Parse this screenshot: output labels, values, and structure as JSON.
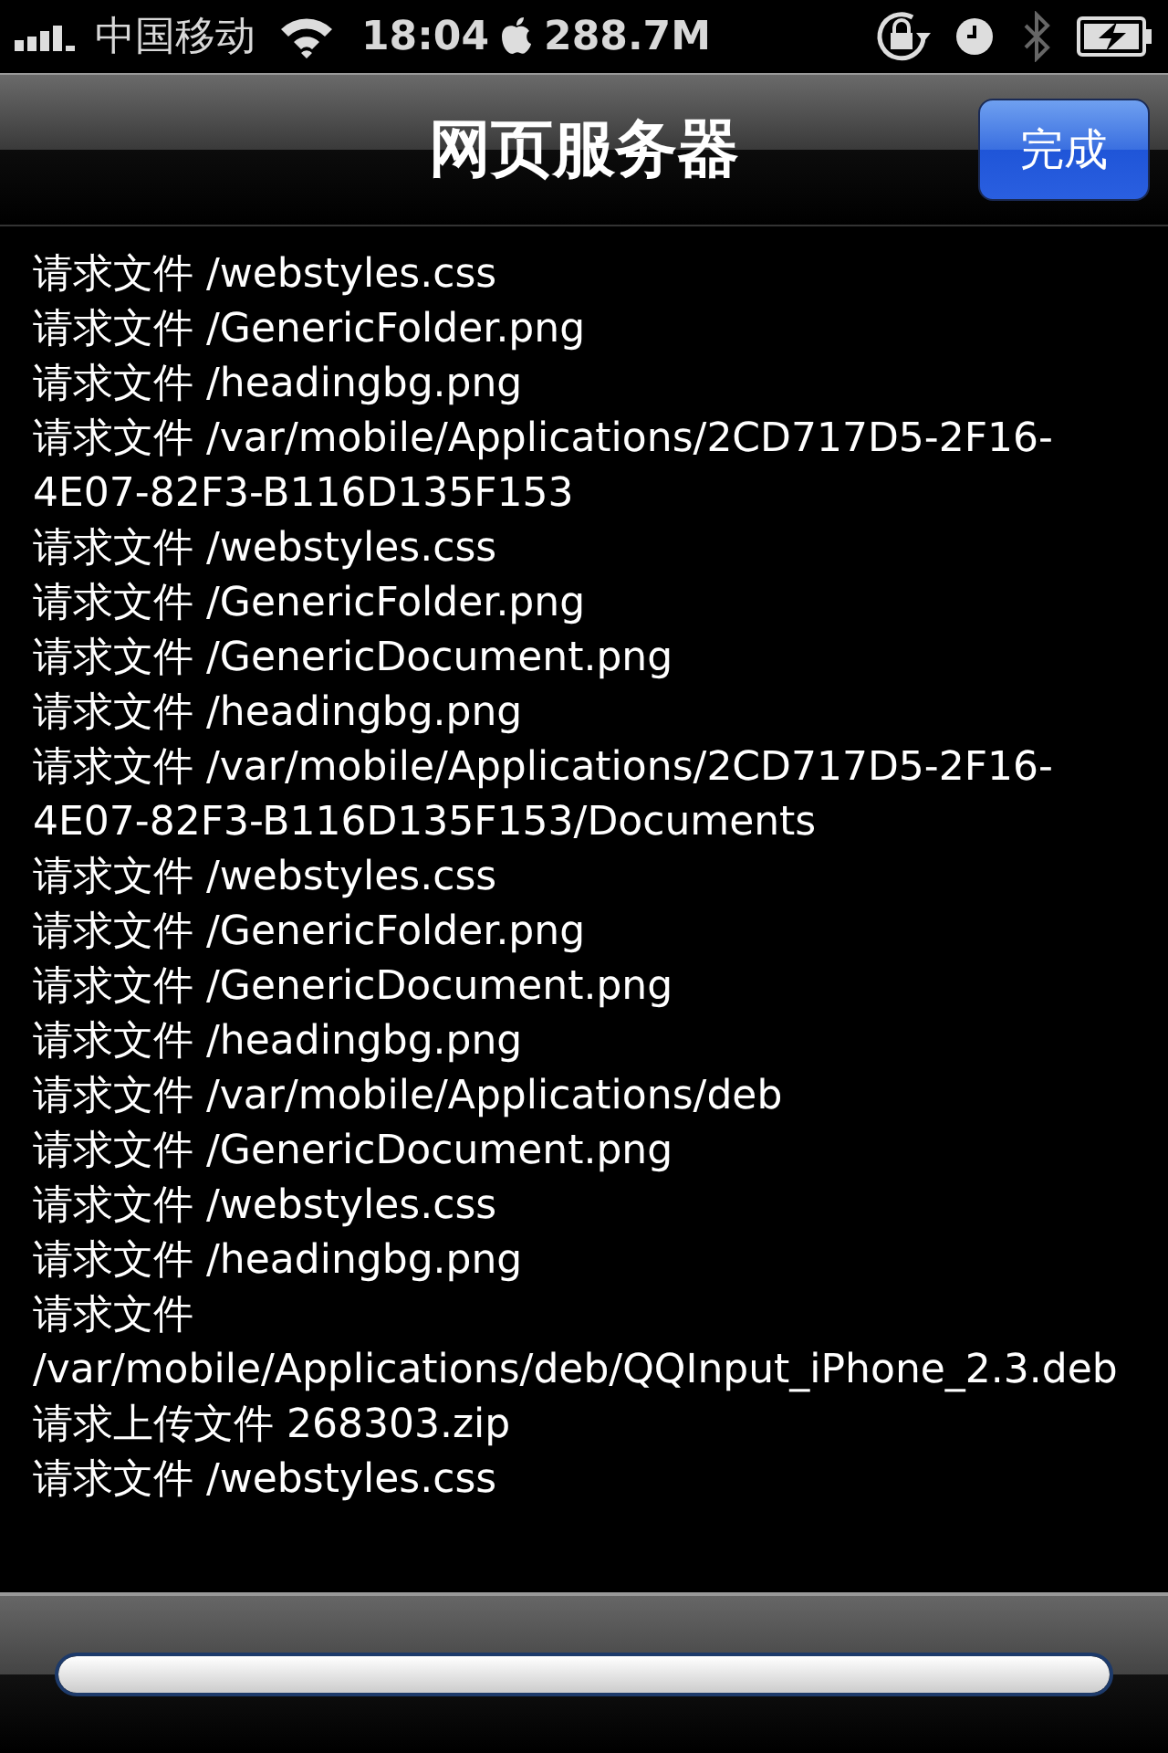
{
  "status_bar": {
    "carrier": "中国移动",
    "time": "18:04",
    "memory": "288.7M"
  },
  "nav_bar": {
    "title": "网页服务器",
    "done_button": "完成"
  },
  "log": {
    "lines": [
      "请求文件 /webstyles.css",
      "请求文件 /GenericFolder.png",
      "请求文件 /headingbg.png",
      "请求文件 /var/mobile/Applications/2CD717D5-2F16-4E07-82F3-B116D135F153",
      "请求文件 /webstyles.css",
      "请求文件 /GenericFolder.png",
      "请求文件 /GenericDocument.png",
      "请求文件 /headingbg.png",
      "请求文件 /var/mobile/Applications/2CD717D5-2F16-4E07-82F3-B116D135F153/Documents",
      "请求文件 /webstyles.css",
      "请求文件 /GenericFolder.png",
      "请求文件 /GenericDocument.png",
      "请求文件 /headingbg.png",
      "请求文件 /var/mobile/Applications/deb",
      "请求文件 /GenericDocument.png",
      "请求文件 /webstyles.css",
      "请求文件 /headingbg.png",
      "请求文件 /var/mobile/Applications/deb/QQInput_iPhone_2.3.deb",
      "请求上传文件 268303.zip",
      "请求文件 /webstyles.css"
    ]
  },
  "toolbar": {
    "progress": {
      "level": 1
    }
  }
}
